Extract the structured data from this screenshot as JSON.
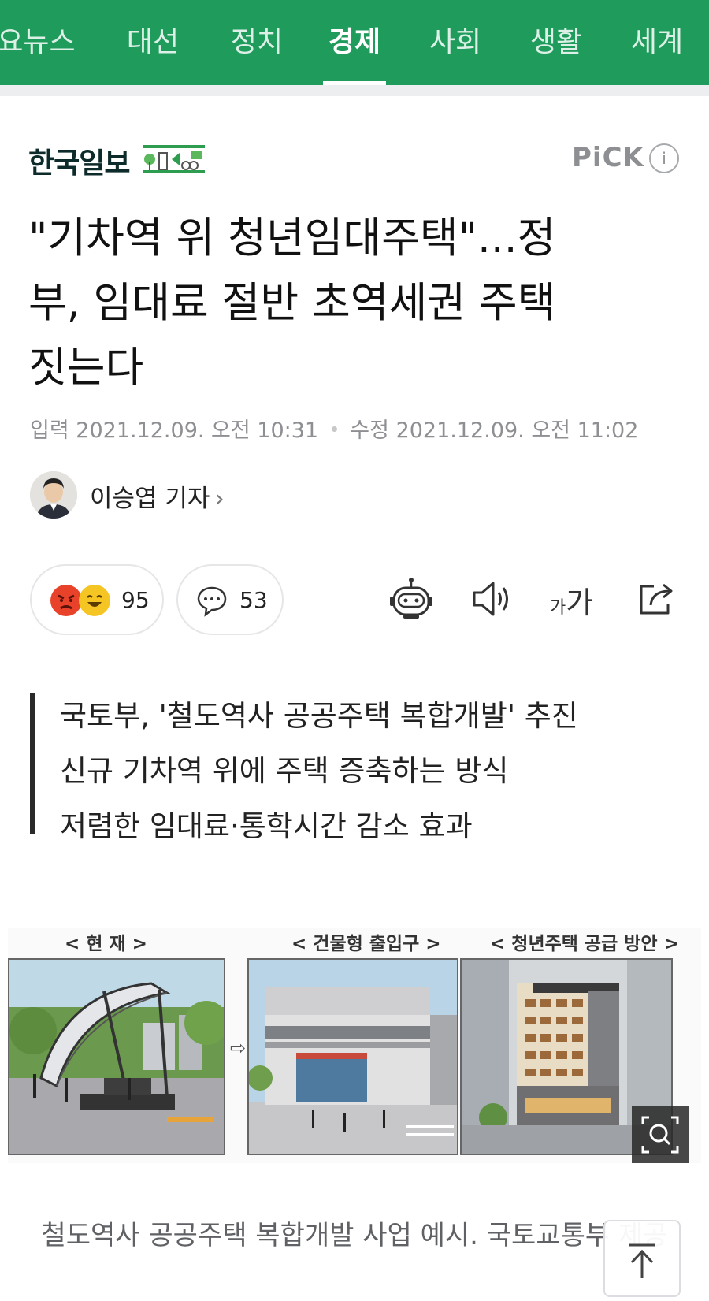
{
  "nav": {
    "tabs": [
      {
        "label": "요뉴스"
      },
      {
        "label": "대선"
      },
      {
        "label": "정치"
      },
      {
        "label": "경제"
      },
      {
        "label": "사회"
      },
      {
        "label": "생활"
      },
      {
        "label": "세계"
      }
    ],
    "active_index": 3,
    "bg_color": "#1f9b5c"
  },
  "press": {
    "name": "한국일보",
    "pick_label": "PiCK",
    "info_label": "i"
  },
  "article": {
    "headline_lines": [
      "\"기차역 위 청년임대주택\"...정",
      "부, 임대료 절반 초역세권 주택",
      "짓는다"
    ],
    "input_label": "입력",
    "input_date": "2021.12.09. 오전 10:31",
    "edit_label": "수정",
    "edit_date": "2021.12.09. 오전 11:02",
    "reporter": "이승엽 기자",
    "reporter_chevron": "›"
  },
  "reactions": {
    "count": "95",
    "comments": "53",
    "font_small": "가",
    "font_large": "가"
  },
  "summary": [
    "국토부, '철도역사 공공주택 복합개발' 추진",
    "신규 기차역 위에 주택 증축하는 방식",
    "저렴한 임대료·통학시간 감소 효과"
  ],
  "photo": {
    "label_current": "< 현    재 >",
    "label_entrance": "< 건물형 출입구 >",
    "label_supply": "< 청년주택 공급 방안 >",
    "arrow": "⇨",
    "caption": "철도역사 공공주택 복합개발 사업 예시. 국토교통부 제공"
  },
  "icons": [
    "angry-emoji-icon",
    "laugh-emoji-icon",
    "comment-icon",
    "robot-summary-icon",
    "speaker-icon",
    "font-size-icon",
    "share-icon",
    "zoom-icon",
    "arrow-up-icon"
  ]
}
